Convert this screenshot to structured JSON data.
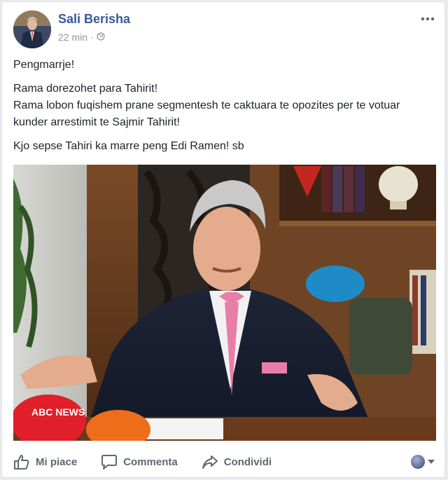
{
  "post": {
    "author": "Sali Berisha",
    "time": "22 min",
    "separator": "·",
    "paragraphs": [
      "Pengmarrje!",
      "Rama dorezohet para Tahirit!",
      "Rama lobon fuqishem prane segmentesh te caktuara te opozites per te votuar kunder arrestimit te Sajmir Tahirit!",
      "Kjo sepse Tahiri ka marre peng Edi Ramen! sb"
    ],
    "more_icon": "more-horizontal-icon"
  },
  "photo": {
    "microphone_labels": [
      "ABC NEWS"
    ]
  },
  "actions": {
    "like": "Mi piace",
    "comment": "Commenta",
    "share": "Condividi"
  },
  "colors": {
    "author": "#365899",
    "meta": "#90949c",
    "text": "#1d2129",
    "action": "#606770",
    "background": "#e9ebee"
  }
}
